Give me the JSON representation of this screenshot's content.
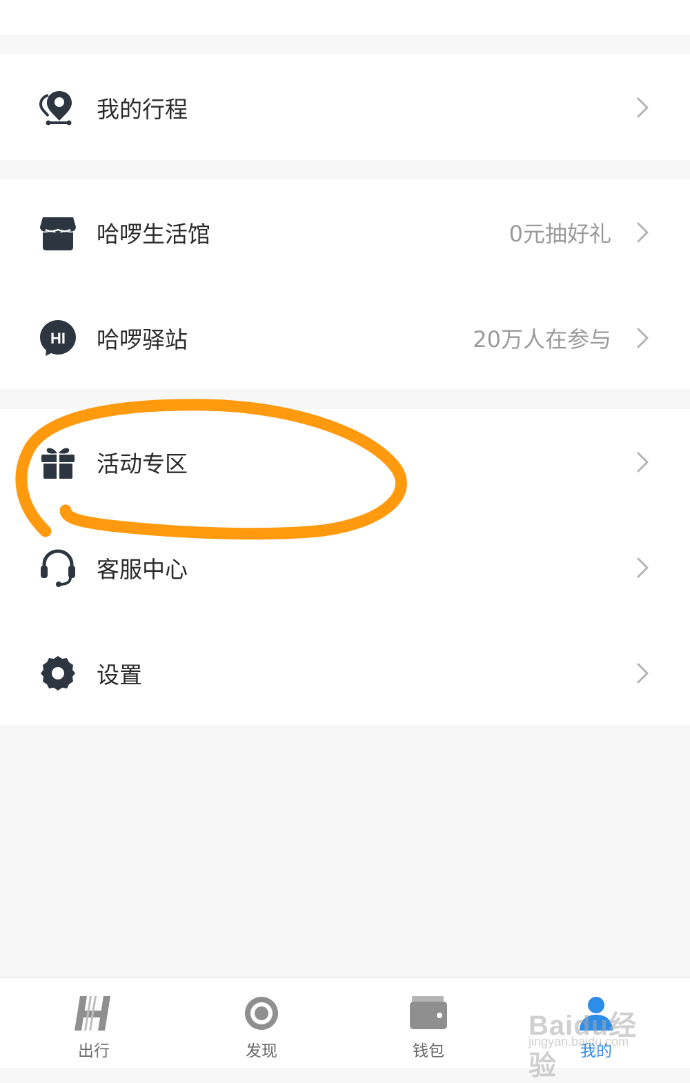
{
  "menu": {
    "trip": {
      "label": "我的行程",
      "hint": ""
    },
    "life_store": {
      "label": "哈啰生活馆",
      "hint": "0元抽好礼"
    },
    "station": {
      "label": "哈啰驿站",
      "hint": "20万人在参与"
    },
    "events": {
      "label": "活动专区",
      "hint": ""
    },
    "service": {
      "label": "客服中心",
      "hint": ""
    },
    "settings": {
      "label": "设置",
      "hint": ""
    }
  },
  "icons": {
    "trip": "map-pin-icon",
    "life_store": "store-icon",
    "station": "hi-chat-icon",
    "events": "gift-icon",
    "service": "headset-icon",
    "settings": "gear-icon",
    "chevron": "chevron-right-icon"
  },
  "tabbar": {
    "tabs": [
      {
        "label": "出行",
        "icon": "hello-logo-icon",
        "active": false
      },
      {
        "label": "发现",
        "icon": "discover-icon",
        "active": false
      },
      {
        "label": "钱包",
        "icon": "wallet-icon",
        "active": false
      },
      {
        "label": "我的",
        "icon": "profile-icon",
        "active": true
      }
    ]
  },
  "watermark": {
    "brand": "Baidu经验",
    "url": "jingyan.baidu.com"
  },
  "colors": {
    "icon": "#2d3640",
    "annotation": "#ff9a0e",
    "active_tab": "#2e8de8",
    "hint_text": "#9a9a9a"
  }
}
